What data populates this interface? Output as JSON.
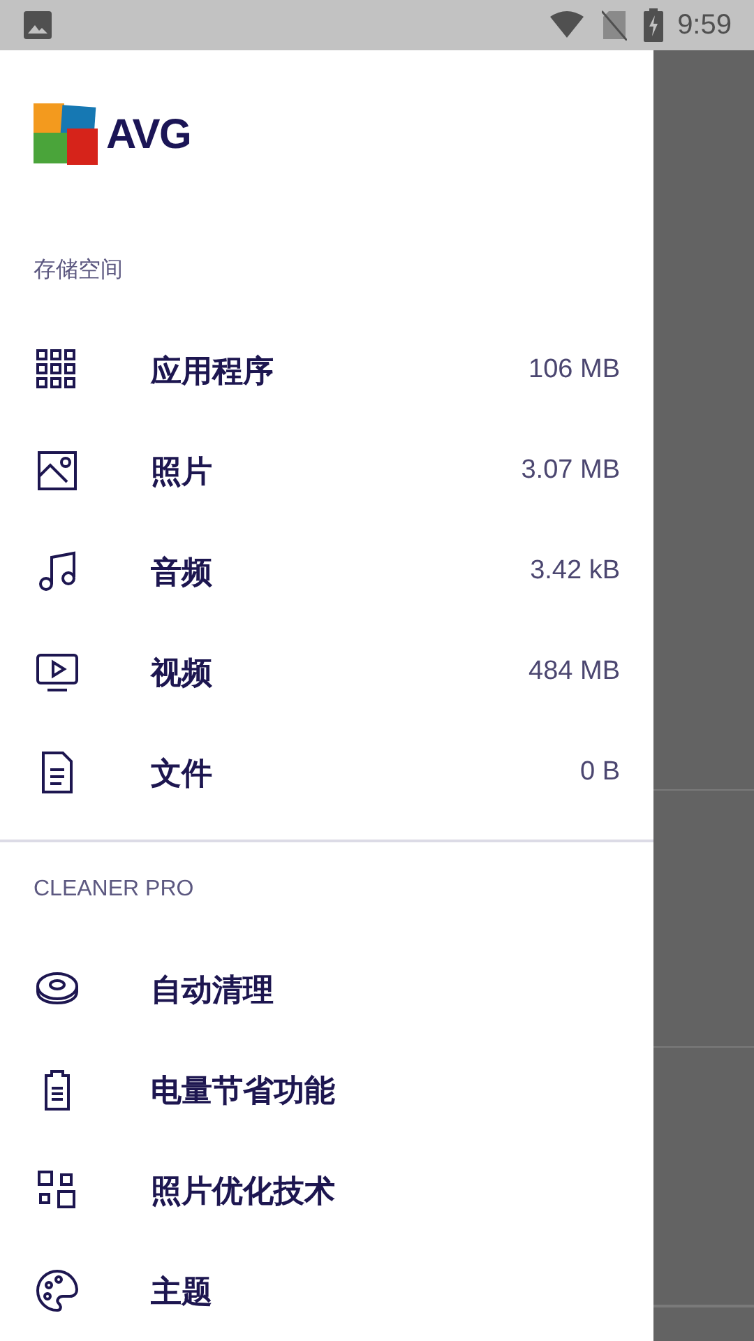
{
  "status_bar": {
    "time": "9:59"
  },
  "logo": {
    "text": "AVG"
  },
  "sections": [
    {
      "title": "存储空间",
      "items": [
        {
          "label": "应用程序",
          "value": "106 MB"
        },
        {
          "label": "照片",
          "value": "3.07 MB"
        },
        {
          "label": "音频",
          "value": "3.42 kB"
        },
        {
          "label": "视频",
          "value": "484 MB"
        },
        {
          "label": "文件",
          "value": "0 B"
        }
      ]
    },
    {
      "title": "CLEANER PRO",
      "items": [
        {
          "label": "自动清理"
        },
        {
          "label": "电量节省功能"
        },
        {
          "label": "照片优化技术"
        },
        {
          "label": "主题"
        }
      ]
    }
  ]
}
